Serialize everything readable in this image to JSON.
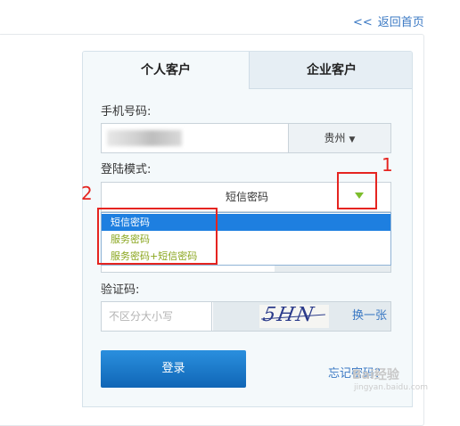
{
  "header": {
    "back_chevron": "<<",
    "back_label": "返回首页"
  },
  "tabs": [
    {
      "label": "个人客户"
    },
    {
      "label": "企业客户"
    }
  ],
  "form": {
    "phone_label": "手机号码:",
    "region_value": "贵州",
    "mode_label": "登陆模式:",
    "mode_value": "短信密码",
    "mode_options": [
      "短信密码",
      "服务密码",
      "服务密码+短信密码"
    ],
    "captcha_label": "验证码:",
    "captcha_placeholder": "不区分大小写",
    "captcha_image_text": "5HN",
    "refresh_label": "换一张",
    "login_label": "登录",
    "forgot_label": "忘记密码？"
  },
  "annotations": {
    "marker_1": "1",
    "marker_2": "2"
  },
  "watermark": {
    "text": "Bai经验",
    "sub": "jingyan.baidu.com"
  },
  "colors": {
    "accent": "#3a78c3",
    "selected": "#1e7fe0",
    "option": "#8aa61e",
    "annotation": "#e52420",
    "button": "#1a7acc"
  }
}
